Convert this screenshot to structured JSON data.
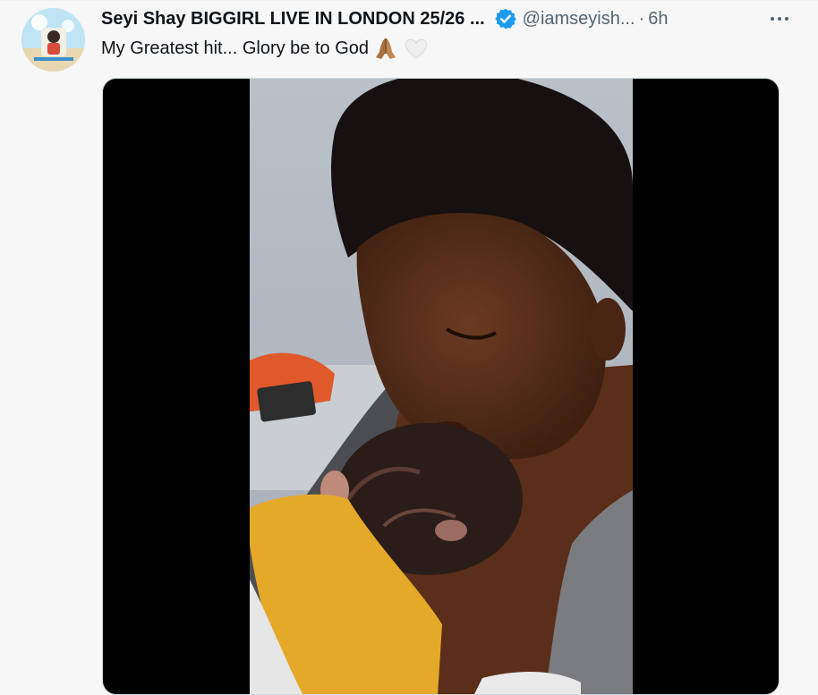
{
  "tweet": {
    "display_name": "Seyi Shay BIGGIRL LIVE IN LONDON 25/26 ...",
    "verified": true,
    "handle": "@iamseyish...",
    "separator": "·",
    "time": "6h",
    "text": "My Greatest hit... Glory be to God",
    "emojis": [
      "folded-hands-emoji",
      "white-heart-emoji"
    ]
  },
  "colors": {
    "background": "#f7f7f7",
    "text_primary": "#0f1419",
    "text_secondary": "#536471",
    "verified_blue": "#1d9bf0"
  },
  "icons": [
    "verified-badge-icon",
    "more-options-icon"
  ]
}
